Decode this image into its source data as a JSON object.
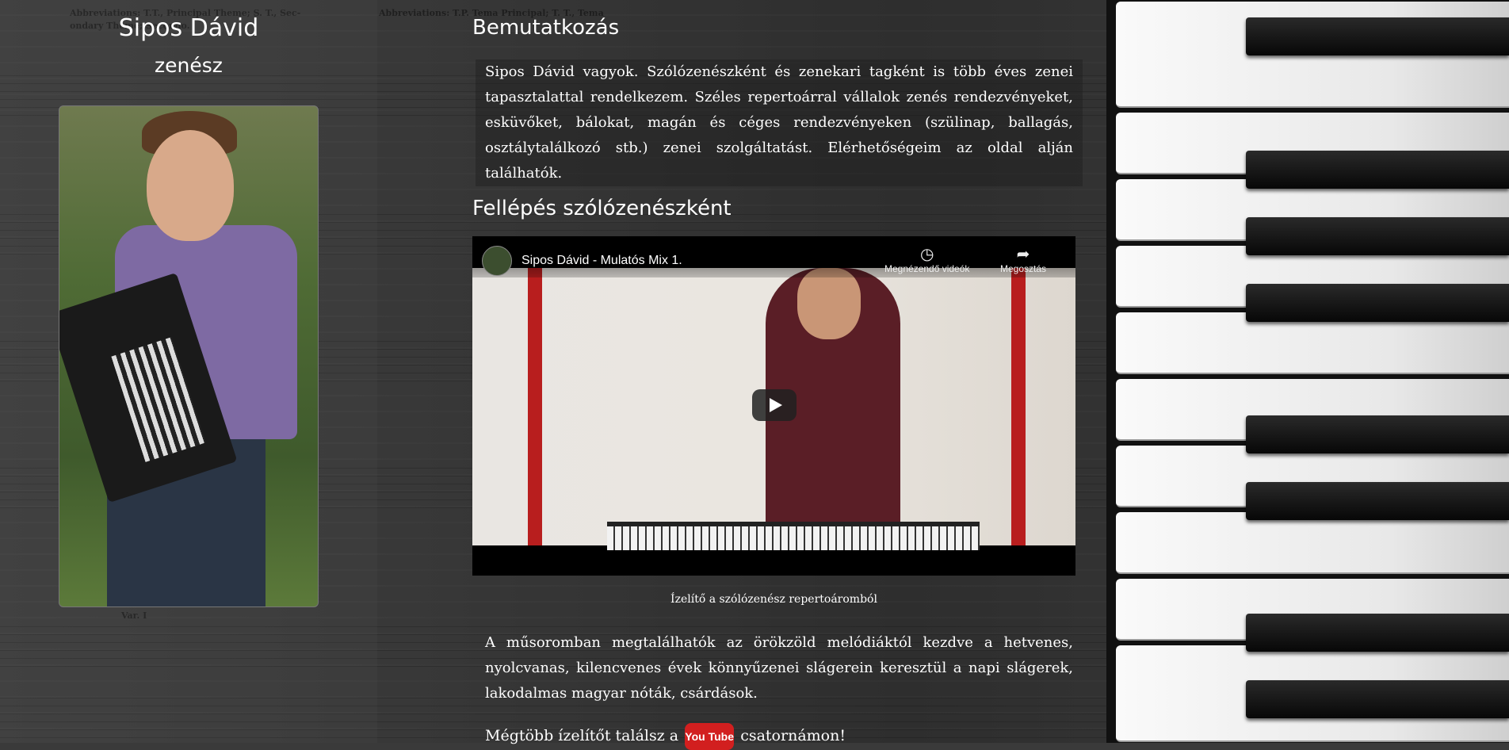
{
  "background": {
    "captions": [
      "Abbreviations:   T.T., Principal Theme;   S. T., Sec-",
      "ondary Theme;              Secondo.",
      "Abbreviations:   T.P. Tema Principal;   T. T., Tema",
      "Var. I"
    ]
  },
  "sidebar": {
    "name": "Sipos Dávid",
    "role": "zenész"
  },
  "intro": {
    "heading": "Bemutatkozás",
    "text": "Sipos Dávid vagyok. Szólózenészként és zenekari tagként is több éves zenei tapasztalattal rendelkezem. Széles repertoárral vállalok zenés rendezvényeket, esküvőket, bálokat, magán és céges rendezvényeken (szülinap, ballagás, osztálytalálkozó stb.) zenei szolgáltatást. Elérhetőségeim az oldal alján találhatók."
  },
  "solo": {
    "heading": "Fellépés szólózenészként",
    "video": {
      "title": "Sipos Dávid - Mulatós Mix 1.",
      "watch_later": "Megnézendő videók",
      "share": "Megosztás"
    },
    "caption": "Ízelítő a szólózenész repertoáromból",
    "repertoire": "A műsoromban megtalálhatók az örökzöld melódiáktól kezdve a hetvenes, nyolcvanas, kilencvenes évek könnyűzenei slágerein keresztül a napi slágerek, lakodalmas magyar nóták, csárdások.",
    "more_prefix": "Mégtöbb ízelítőt találsz a",
    "youtube_label": "You Tube",
    "more_suffix": "csatornámon!"
  }
}
